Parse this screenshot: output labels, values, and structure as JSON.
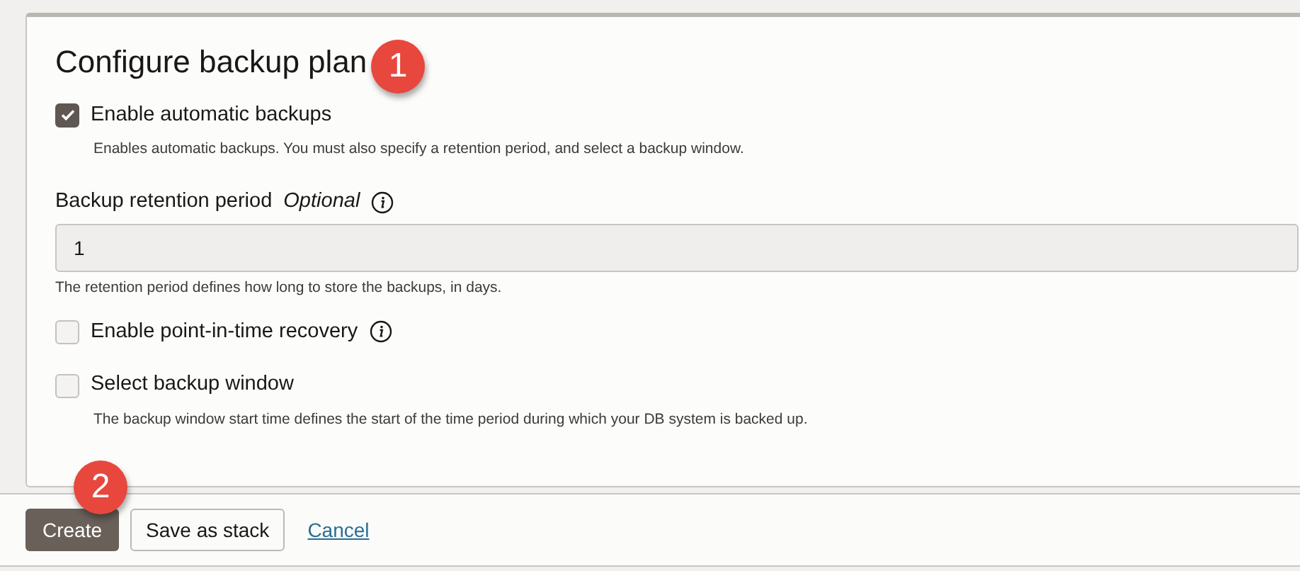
{
  "section": {
    "title": "Configure backup plan"
  },
  "callouts": [
    {
      "label": "1"
    },
    {
      "label": "2"
    }
  ],
  "options": [
    {
      "kind": "checkbox",
      "label": "Enable automatic backups",
      "checked": true,
      "info": false,
      "help": "Enables automatic backups. You must also specify a retention period, and select a backup window."
    },
    {
      "kind": "field",
      "label": "Backup retention period",
      "optional": "Optional",
      "info": true,
      "value": "1",
      "help": "The retention period defines how long to store the backups, in days."
    },
    {
      "kind": "checkbox",
      "label": "Enable point-in-time recovery",
      "checked": false,
      "info": true
    },
    {
      "kind": "checkbox",
      "label": "Select backup window",
      "checked": false,
      "info": false,
      "help": "The backup window start time defines the start of the time period during which your DB system is backed up."
    }
  ],
  "buttons": [
    {
      "kind": "primary",
      "label": "Create"
    },
    {
      "kind": "secondary",
      "label": "Save as stack"
    },
    {
      "kind": "link",
      "label": "Cancel"
    }
  ]
}
